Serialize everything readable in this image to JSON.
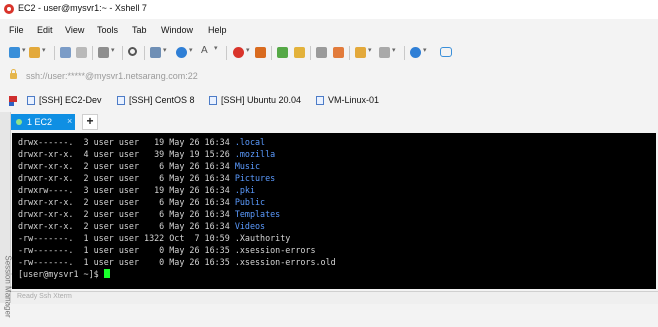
{
  "window": {
    "title": "EC2 - user@mysvr1:~ - Xshell 7"
  },
  "menu": [
    "File",
    "Edit",
    "View",
    "Tools",
    "Tab",
    "Window",
    "Help"
  ],
  "address": {
    "text": "ssh://user:*****@mysvr1.netsarang.com:22"
  },
  "links": [
    "[SSH] EC2-Dev",
    "[SSH] CentOS 8",
    "[SSH] Ubuntu 20.04",
    "VM-Linux-01"
  ],
  "side_panel": {
    "label": "Session Manager"
  },
  "tabs": {
    "active_label": "1 EC2",
    "close": "×",
    "add": "+"
  },
  "terminal": {
    "rows": [
      {
        "meta": "drwx------.  3 user user   19 May 26 16:34 ",
        "name": ".local",
        "dir": true
      },
      {
        "meta": "drwxr-xr-x.  4 user user   39 May 19 15:26 ",
        "name": ".mozilla",
        "dir": true
      },
      {
        "meta": "drwxr-xr-x.  2 user user    6 May 26 16:34 ",
        "name": "Music",
        "dir": true
      },
      {
        "meta": "drwxr-xr-x.  2 user user    6 May 26 16:34 ",
        "name": "Pictures",
        "dir": true
      },
      {
        "meta": "drwxrw----.  3 user user   19 May 26 16:34 ",
        "name": ".pki",
        "dir": true
      },
      {
        "meta": "drwxr-xr-x.  2 user user    6 May 26 16:34 ",
        "name": "Public",
        "dir": true
      },
      {
        "meta": "drwxr-xr-x.  2 user user    6 May 26 16:34 ",
        "name": "Templates",
        "dir": true
      },
      {
        "meta": "drwxr-xr-x.  2 user user    6 May 26 16:34 ",
        "name": "Videos",
        "dir": true
      },
      {
        "meta": "-rw-------.  1 user user 1322 Oct  7 10:59 ",
        "name": ".Xauthority",
        "dir": false
      },
      {
        "meta": "-rw-------.  1 user user    0 May 26 16:35 ",
        "name": ".xsession-errors",
        "dir": false
      },
      {
        "meta": "-rw-------.  1 user user    0 May 26 16:35 ",
        "name": ".xsession-errors.old",
        "dir": false
      }
    ],
    "prompt": "[user@mysvr1 ~]$ "
  },
  "status": {
    "text": "Ready        Ssh          Xterm"
  },
  "colors": {
    "tab_active": "#0f8fe3",
    "dir_blue": "#5b9bff",
    "cursor": "#19ff2b",
    "terminal_bg": "#000000"
  }
}
